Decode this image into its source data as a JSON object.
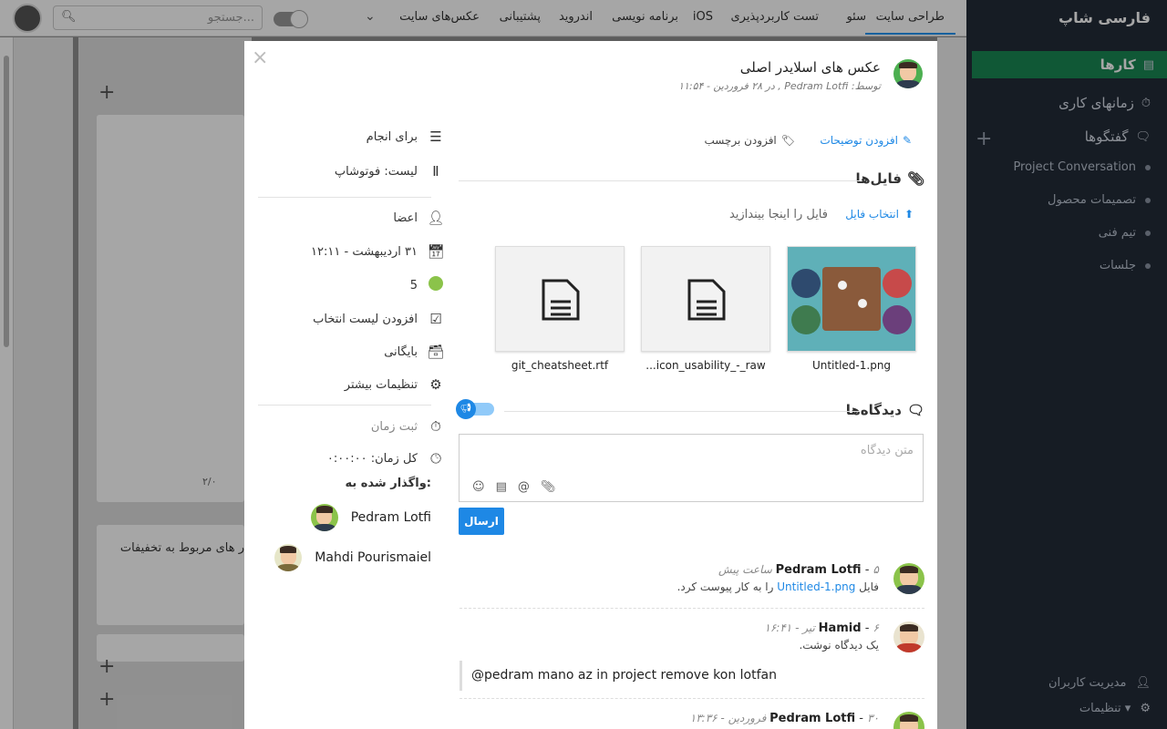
{
  "topbar": {
    "tabs": [
      "طراحی سایت",
      "سئو",
      "تست کاربردپذیری",
      "iOS",
      "برنامه نویسی",
      "اندروید",
      "پشتیبانی",
      "عکس‌های سایت"
    ],
    "search_placeholder": "جستجو..."
  },
  "sidebar": {
    "brand": "فارسی شاپ",
    "items": [
      {
        "label": "کارها",
        "icon": "tasks-icon",
        "active": true
      },
      {
        "label": "زمانهای کاری",
        "icon": "timer-icon"
      },
      {
        "label": "گفتگوها",
        "icon": "chat-icon"
      }
    ],
    "conversations": [
      "Project Conversation",
      "تصمیمات محصول",
      "تیم فنی",
      "جلسات"
    ],
    "bottom": [
      "مدیریت کاربران",
      "تنظیمات ▾"
    ]
  },
  "board": {
    "card_text": "ر های مربوط به تخفیفات",
    "counter": "۲/۰"
  },
  "modal": {
    "title": "عکس های اسلایدر اصلی",
    "meta": "توسط: Pedram Lotfi , در ۲۸ فروردین - ۱۱:۵۴",
    "add_description": "افزودن توضیحات",
    "add_label": "افزودن برچسب",
    "files_title": "فایل‌ها",
    "drop_text": "فایل را اینجا بیندازید",
    "pick_file": "انتخاب فایل",
    "files": [
      "Untitled-1.png",
      "icon_usability_-_raw...",
      "git_cheatsheet.rtf"
    ],
    "comments_title": "دیدگاه‌ها",
    "comment_placeholder": "متن دیدگاه",
    "send": "ارسال",
    "comments": [
      {
        "name": "Pedram Lotfi",
        "time": "۵ ساعت پیش",
        "body_pre": "فایل",
        "link": "Untitled-1.png",
        "body_post": "را به کار پیوست کرد."
      },
      {
        "name": "Hamid",
        "time": "۶ تیر - ۱۶:۴۱",
        "body": "یک دیدگاه نوشت.",
        "quote": "@pedram mano az in project remove kon lotfan"
      },
      {
        "name": "Pedram Lotfi",
        "time": "۳۰ فروردین - ۱۳:۳۶"
      }
    ],
    "props": {
      "todo": "برای انجام",
      "list": "لیست: فوتوشاپ",
      "members": "اعضا",
      "due": "۳۱ اردیبهشت - ۱۲:۱۱",
      "points": "5",
      "checklist": "افزودن لیست انتخاب",
      "archive": "بایگانی",
      "more": "تنظیمات بیشتر",
      "log_time": "ثبت زمان",
      "total_time": "کل زمان: ۰:۰۰:۰۰",
      "assigned_to": "واگذار شده به:",
      "assignees": [
        "Pedram Lotfi",
        "Mahdi Pourismaiel"
      ]
    }
  },
  "colors": {
    "accent": "#1e88e5",
    "sidebar_bg": "#222b38",
    "active_green": "#198754"
  }
}
